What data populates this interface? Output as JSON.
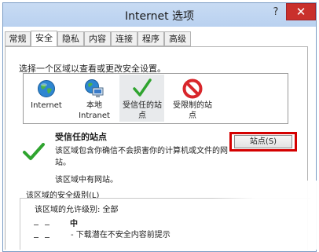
{
  "window": {
    "title": "Internet 选项",
    "help_glyph": "?",
    "close_glyph": "✕"
  },
  "tabs": [
    {
      "label": "常规"
    },
    {
      "label": "安全",
      "active": true
    },
    {
      "label": "隐私"
    },
    {
      "label": "内容"
    },
    {
      "label": "连接"
    },
    {
      "label": "程序"
    },
    {
      "label": "高级"
    }
  ],
  "security": {
    "instruction": "选择一个区域以查看或更改安全设置。",
    "zones": [
      {
        "label": "Internet",
        "icon": "globe-icon"
      },
      {
        "label": "本地 Intranet",
        "icon": "intranet-icon"
      },
      {
        "label": "受信任的站点",
        "icon": "checkmark-icon"
      },
      {
        "label": "受限制的站点",
        "icon": "restricted-icon"
      }
    ],
    "selected_zone": {
      "title": "受信任的站点",
      "description": "该区域包含你确信不会损害你的计算机或文件的网站。",
      "note": "该区域中有网站。",
      "sites_button": "站点(S)"
    },
    "level_label": "该区域的安全级别(L)",
    "allowed_levels": "该区域的允许级别: 全部",
    "level_name": "中",
    "level_description": "- 下载潜在不安全内容前提示"
  },
  "colors": {
    "title_bar": "#c4d8f2",
    "close_button": "#c9302c",
    "highlight_border": "#d40000",
    "check_green": "#2fa42f",
    "restricted_red": "#d8262b"
  }
}
